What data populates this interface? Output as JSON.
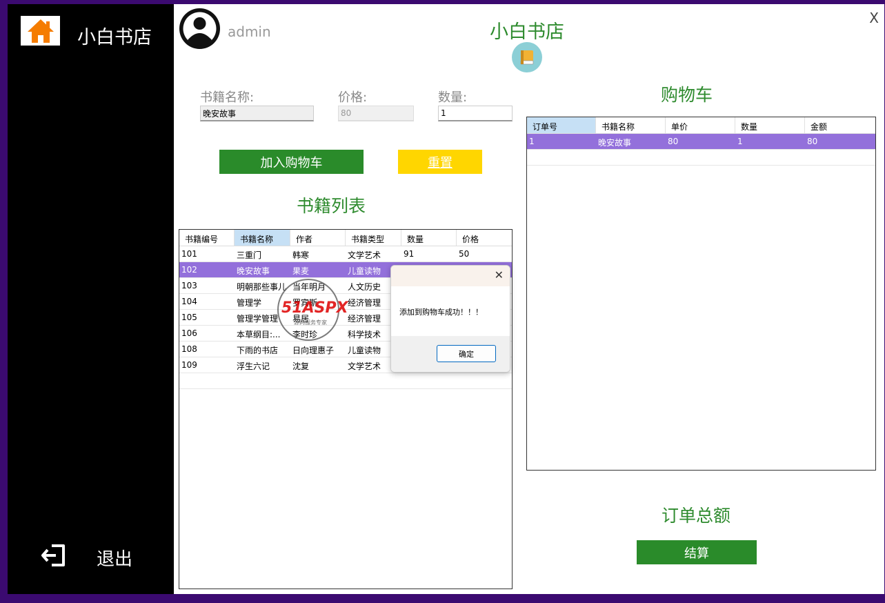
{
  "sidebar": {
    "title": "小白书店",
    "logout_label": "退出"
  },
  "header": {
    "username": "admin",
    "close_label": "X",
    "shop_title": "小白书店"
  },
  "form": {
    "name_label": "书籍名称:",
    "name_value": "晚安故事",
    "price_label": "价格:",
    "price_value": "80",
    "qty_label": "数量:",
    "qty_value": "1",
    "add_button": "加入购物车",
    "reset_button": "重置"
  },
  "book_list": {
    "title": "书籍列表",
    "columns": [
      "书籍编号",
      "书籍名称",
      "作者",
      "书籍类型",
      "数量",
      "价格"
    ],
    "rows": [
      [
        "101",
        "三重门",
        "韩寒",
        "文学艺术",
        "91",
        "50"
      ],
      [
        "102",
        "晚安故事",
        "果麦",
        "儿童读物",
        "",
        ""
      ],
      [
        "103",
        "明朝那些事儿",
        "当年明月",
        "人文历史",
        "",
        ""
      ],
      [
        "104",
        "管理学",
        "罗宾斯",
        "经济管理",
        "",
        ""
      ],
      [
        "105",
        "管理学管理",
        "易居",
        "经济管理",
        "",
        ""
      ],
      [
        "106",
        "本草纲目:...",
        "李时珍",
        "科学技术",
        "",
        ""
      ],
      [
        "108",
        "下雨的书店",
        "日向理惠子",
        "儿童读物",
        "",
        ""
      ],
      [
        "109",
        "浮生六记",
        "沈复",
        "文学艺术",
        "",
        ""
      ]
    ]
  },
  "cart": {
    "title": "购物车",
    "columns": [
      "订单号",
      "书籍名称",
      "单价",
      "数量",
      "金额"
    ],
    "rows": [
      [
        "1",
        "晚安故事",
        "80",
        "1",
        "80"
      ]
    ],
    "total_label": "订单总额",
    "checkout_button": "结算"
  },
  "dialog": {
    "message": "添加到购物车成功！！！",
    "ok_button": "确定",
    "close_label": "✕"
  },
  "watermark": {
    "logo": "51ASPX",
    "sub": "源码服务专家"
  },
  "colors": {
    "frame": "#3b0a70",
    "accent_green": "#2a8b2a",
    "reset_yellow": "#ffd600",
    "selected_row": "#9370db",
    "home_orange": "#f57c00"
  }
}
